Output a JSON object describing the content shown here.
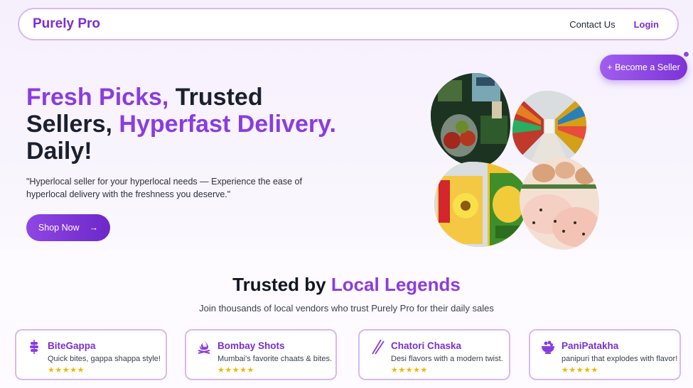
{
  "nav": {
    "brand": "Purely Pro",
    "contact": "Contact Us",
    "login": "Login"
  },
  "seller_button": "+ Become a Seller",
  "hero": {
    "title_part1": "Fresh Picks,",
    "title_part2": " Trusted Sellers,",
    "title_part3": " Hyperfast Delivery.",
    "title_part4": " Daily!",
    "quote": "\"Hyperlocal seller for your hyperlocal needs — Experience the ease of hyperlocal delivery with the freshness you deserve.\"",
    "shop_label": "Shop Now",
    "shop_arrow": "→"
  },
  "trusted": {
    "title_plain": "Trusted by ",
    "title_accent": "Local Legends",
    "subtitle": "Join thousands of local vendors who trust Purely Pro for their daily sales"
  },
  "vendors": [
    {
      "name": "BiteGappa",
      "desc": "Quick bites, gappa shappa style!",
      "stars": "★★★★★",
      "icon": "kebab-icon"
    },
    {
      "name": "Bombay Shots",
      "desc": "Mumbai's favorite chaats & bites.",
      "stars": "★★★★★",
      "icon": "campfire-icon"
    },
    {
      "name": "Chatori Chaska",
      "desc": "Desi flavors with a modern twist.",
      "stars": "★★★★★",
      "icon": "chopsticks-icon"
    },
    {
      "name": "PaniPatakha",
      "desc": "panipuri that explodes with flavor!",
      "stars": "★★★★★",
      "icon": "bowl-icon"
    }
  ],
  "colors": {
    "accent": "#8a3ce0",
    "border": "#d8b8f2",
    "star": "#f2b705"
  }
}
